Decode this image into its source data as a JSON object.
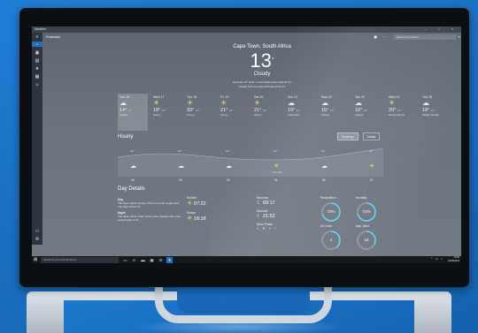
{
  "window": {
    "title": "Weather",
    "controls": [
      "–",
      "□",
      "×"
    ]
  },
  "appbar": {
    "section": "Forecast",
    "search_placeholder": "Search for location"
  },
  "nav": {
    "icons": [
      "hamburger-icon",
      "home-icon",
      "maps-icon",
      "historical-icon",
      "places-icon",
      "news-icon",
      "smile-icon",
      "people-icon",
      "settings-icon"
    ]
  },
  "hero": {
    "city": "Cape Town, South Africa",
    "temp": "13",
    "unit": "°",
    "condition": "Cloudy",
    "stats_line1": "Feels like  13°    Wind  ↘ 6 km/h    Barometer  1024.00 mb",
    "stats_line2": "Visibility  8 km    Humidity  93%    Dew Point  12°"
  },
  "days": [
    {
      "name": "Tue 16",
      "icon": "cloud",
      "high": "14°",
      "low": "11°",
      "desc": "Cloudy"
    },
    {
      "name": "Wed 17",
      "icon": "sun",
      "high": "18°",
      "low": "10°",
      "desc": "Sunny"
    },
    {
      "name": "Thu 18",
      "icon": "sun",
      "high": "20°",
      "low": "11°",
      "desc": "Sunny"
    },
    {
      "name": "Fri 19",
      "icon": "sun",
      "high": "21°",
      "low": "12°",
      "desc": "Sunny"
    },
    {
      "name": "Sat 20",
      "icon": "sun",
      "high": "21°",
      "low": "12°",
      "desc": "Sunny"
    },
    {
      "name": "Sun 21",
      "icon": "cloud",
      "high": "19°",
      "low": "13°",
      "desc": "Light Rain"
    },
    {
      "name": "Mon 22",
      "icon": "cloud",
      "high": "15°",
      "low": "11°",
      "desc": "Cloudy"
    },
    {
      "name": "Tue 23",
      "icon": "cloud",
      "high": "16°",
      "low": "11°",
      "desc": "Cloudy"
    },
    {
      "name": "Wed 24",
      "icon": "sun",
      "high": "20°",
      "low": "11°",
      "desc": "Mostly Sunny"
    },
    {
      "name": "Thu 25",
      "icon": "cloud",
      "high": "18°",
      "low": "12°",
      "desc": "Mostly Cloudy"
    }
  ],
  "hourly": {
    "title": "Hourly",
    "toggle_summary": "Summary",
    "toggle_details": "Details",
    "times": [
      "16",
      "19",
      "22",
      "01",
      "04",
      "07"
    ],
    "labels": [
      "14°",
      "13°",
      "13°",
      "12°",
      "12°",
      "12°"
    ],
    "note": "Tue, Wed"
  },
  "day_details": {
    "title": "Day Details",
    "day_label": "Day",
    "day_text": "The skies will be cloudy. It'll be cool with a light wind. The high will be 14.",
    "night_label": "Night",
    "night_text": "The skies will be clear. It'll be cool. Outside with a low temperature of 11.",
    "sunrise_label": "Sunrise",
    "sunrise": "07:22",
    "sunset_label": "Sunset",
    "sunset": "18:18",
    "moonrise_label": "Moonrise",
    "moonrise": "09:17",
    "moonset_label": "Moonset",
    "moonset": "21:52",
    "moonphase_label": "Moon Phase",
    "precip_label": "Precipitation",
    "precip": "70%",
    "humidity_label": "Humidity",
    "humidity": "72%",
    "uv_label": "UV Index",
    "uv": "4",
    "wind_label": "Max. Wind",
    "wind": "15"
  },
  "taskbar": {
    "search_placeholder": "Search the web and Windows",
    "time": "13:00",
    "date": "16/08/2016"
  },
  "colors": {
    "accent": "#1d6fc4",
    "sun": "#f4d35e",
    "gauge_ring": "#5fd3f3"
  }
}
